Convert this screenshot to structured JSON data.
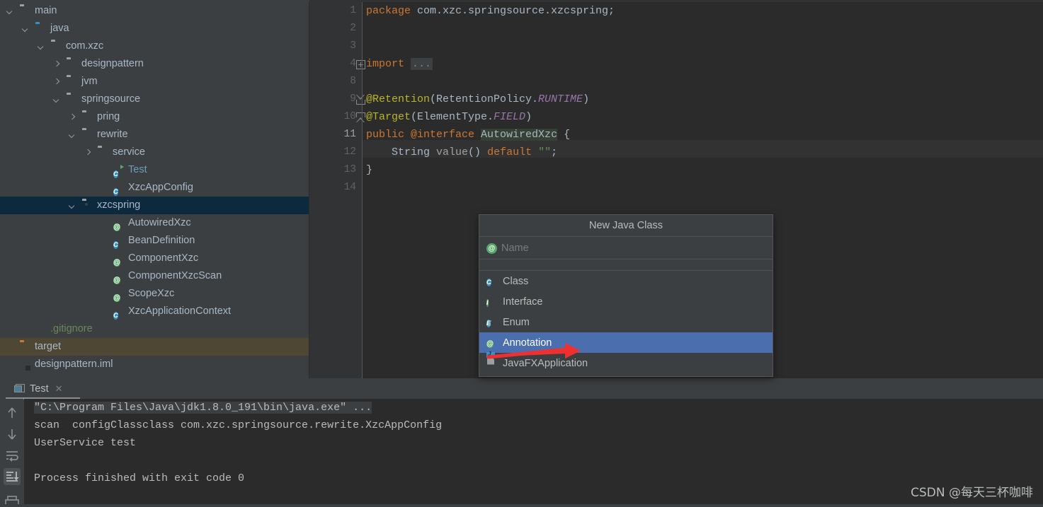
{
  "project_tree": {
    "scrollbar": "vertical-scrollbar",
    "items": [
      {
        "label": "main",
        "indent": 0,
        "twisty": "down",
        "icon": "folder-grey",
        "color": "#a9b7c6",
        "state": "normal"
      },
      {
        "label": "java",
        "indent": 1,
        "twisty": "down",
        "icon": "folder-blue",
        "color": "#a9b7c6",
        "state": "normal"
      },
      {
        "label": "com.xzc",
        "indent": 2,
        "twisty": "down",
        "icon": "package",
        "color": "#a9b7c6",
        "state": "normal"
      },
      {
        "label": "designpattern",
        "indent": 3,
        "twisty": "right",
        "icon": "package",
        "color": "#a9b7c6",
        "state": "normal"
      },
      {
        "label": "jvm",
        "indent": 3,
        "twisty": "right",
        "icon": "package",
        "color": "#a9b7c6",
        "state": "normal"
      },
      {
        "label": "springsource",
        "indent": 3,
        "twisty": "down",
        "icon": "package",
        "color": "#a9b7c6",
        "state": "normal"
      },
      {
        "label": "pring",
        "indent": 4,
        "twisty": "right",
        "icon": "package",
        "color": "#a9b7c6",
        "state": "normal"
      },
      {
        "label": "rewrite",
        "indent": 4,
        "twisty": "down",
        "icon": "package",
        "color": "#a9b7c6",
        "state": "normal"
      },
      {
        "label": "service",
        "indent": 5,
        "twisty": "right",
        "icon": "package",
        "color": "#a9b7c6",
        "state": "normal"
      },
      {
        "label": "Test",
        "indent": 6,
        "twisty": "none",
        "icon": "class-runnable",
        "color": "#6a9fb5",
        "state": "normal"
      },
      {
        "label": "XzcAppConfig",
        "indent": 6,
        "twisty": "none",
        "icon": "class",
        "color": "#a9b7c6",
        "state": "normal"
      },
      {
        "label": "xzcspring",
        "indent": 4,
        "twisty": "down",
        "icon": "package",
        "color": "#a9b7c6",
        "state": "selected"
      },
      {
        "label": "AutowiredXzc",
        "indent": 6,
        "twisty": "none",
        "icon": "annotation",
        "color": "#a9b7c6",
        "state": "normal"
      },
      {
        "label": "BeanDefinition",
        "indent": 6,
        "twisty": "none",
        "icon": "class",
        "color": "#a9b7c6",
        "state": "normal"
      },
      {
        "label": "ComponentXzc",
        "indent": 6,
        "twisty": "none",
        "icon": "annotation",
        "color": "#a9b7c6",
        "state": "normal"
      },
      {
        "label": "ComponentXzcScan",
        "indent": 6,
        "twisty": "none",
        "icon": "annotation",
        "color": "#a9b7c6",
        "state": "normal"
      },
      {
        "label": "ScopeXzc",
        "indent": 6,
        "twisty": "none",
        "icon": "annotation",
        "color": "#a9b7c6",
        "state": "normal"
      },
      {
        "label": "XzcApplicationContext",
        "indent": 6,
        "twisty": "none",
        "icon": "class",
        "color": "#a9b7c6",
        "state": "normal"
      },
      {
        "label": ".gitignore",
        "indent": 1,
        "twisty": "none",
        "icon": "gitignore-file",
        "color": "#6a8759",
        "state": "normal"
      },
      {
        "label": "target",
        "indent": 0,
        "twisty": "none",
        "icon": "folder-orange",
        "color": "#a9b7c6",
        "state": "excluded"
      },
      {
        "label": "designpattern.iml",
        "indent": 0,
        "twisty": "none",
        "icon": "iml-file",
        "color": "#a9b7c6",
        "state": "normal"
      }
    ]
  },
  "editor": {
    "line_numbers": [
      "1",
      "2",
      "3",
      "4",
      "8",
      "9",
      "10",
      "11",
      "12",
      "13",
      "14"
    ],
    "current_line_number": "11",
    "fold_markers": [
      {
        "line": "4",
        "type": "plus"
      },
      {
        "line": "9",
        "type": "start"
      },
      {
        "line": "10",
        "type": "end"
      }
    ],
    "lines": [
      {
        "n": "1",
        "tokens": [
          {
            "t": "package ",
            "c": "kw"
          },
          {
            "t": "com.xzc.springsource.xzcspring;",
            "c": "pl"
          }
        ]
      },
      {
        "n": "2",
        "tokens": []
      },
      {
        "n": "3",
        "tokens": []
      },
      {
        "n": "4",
        "tokens": [
          {
            "t": "import ",
            "c": "kw"
          },
          {
            "t": "...",
            "c": "fold-ph"
          }
        ]
      },
      {
        "n": "8",
        "tokens": []
      },
      {
        "n": "9",
        "tokens": [
          {
            "t": "@Retention",
            "c": "ann"
          },
          {
            "t": "(RetentionPolicy.",
            "c": "pl"
          },
          {
            "t": "RUNTIME",
            "c": "st"
          },
          {
            "t": ")",
            "c": "pl"
          }
        ]
      },
      {
        "n": "10",
        "tokens": [
          {
            "t": "@Target",
            "c": "ann"
          },
          {
            "t": "(ElementType.",
            "c": "pl"
          },
          {
            "t": "FIELD",
            "c": "st"
          },
          {
            "t": ")",
            "c": "pl"
          }
        ]
      },
      {
        "n": "11",
        "tokens": [
          {
            "t": "public ",
            "c": "kw"
          },
          {
            "t": "@interface ",
            "c": "kw"
          },
          {
            "t": "AutowiredXzc",
            "c": "ident-hl"
          },
          {
            "t": " {",
            "c": "pl"
          }
        ]
      },
      {
        "n": "12",
        "tokens": [
          {
            "t": "    String ",
            "c": "pl"
          },
          {
            "t": "value",
            "c": "meth"
          },
          {
            "t": "() ",
            "c": "pl"
          },
          {
            "t": "default ",
            "c": "kw"
          },
          {
            "t": "\"\"",
            "c": "str"
          },
          {
            "t": ";",
            "c": "pl"
          }
        ]
      },
      {
        "n": "13",
        "tokens": [
          {
            "t": "}",
            "c": "pl"
          }
        ]
      },
      {
        "n": "14",
        "tokens": []
      }
    ]
  },
  "popup": {
    "title": "New Java Class",
    "name_placeholder": "Name",
    "name_value": "",
    "name_icon": "annotation-badge-icon",
    "items": [
      {
        "label": "Class",
        "icon": "class-badge",
        "selected": false
      },
      {
        "label": "Interface",
        "icon": "interface-badge",
        "selected": false
      },
      {
        "label": "Enum",
        "icon": "enum-badge",
        "selected": false
      },
      {
        "label": "Annotation",
        "icon": "annotation-badge",
        "selected": true
      },
      {
        "label": "JavaFXApplication",
        "icon": "javafx-icon",
        "selected": false
      }
    ]
  },
  "annotation": {
    "arrow_color": "#f03030",
    "points_to": "Annotation"
  },
  "run_panel": {
    "tab_label": "Test",
    "tab_icon": "run-config-icon",
    "close_icon": "close-icon",
    "toolbar_icons": [
      "arrow-up-icon",
      "arrow-down-icon",
      "soft-wrap-icon",
      "scroll-to-end-icon",
      "print-icon"
    ],
    "console_lines": [
      {
        "text": "\"C:\\Program Files\\Java\\jdk1.8.0_191\\bin\\java.exe\" ...",
        "highlight": true
      },
      {
        "text": "scan  configClassclass com.xzc.springsource.rewrite.XzcAppConfig",
        "highlight": false
      },
      {
        "text": "UserService test",
        "highlight": false
      },
      {
        "text": "",
        "highlight": false
      },
      {
        "text": "Process finished with exit code 0",
        "highlight": false
      }
    ]
  },
  "watermark": {
    "text": "CSDN @每天三杯咖啡"
  },
  "colors": {
    "panel_bg": "#3c3f41",
    "editor_bg": "#2b2b2b",
    "gutter_bg": "#313335",
    "selection": "#0d293e",
    "excluded": "#4e4733",
    "popup_selection": "#4b6eaf",
    "keyword": "#cc7832",
    "annotation": "#bbb529",
    "static_italic": "#9876aa",
    "string": "#6a8759",
    "text": "#a9b7c6"
  }
}
